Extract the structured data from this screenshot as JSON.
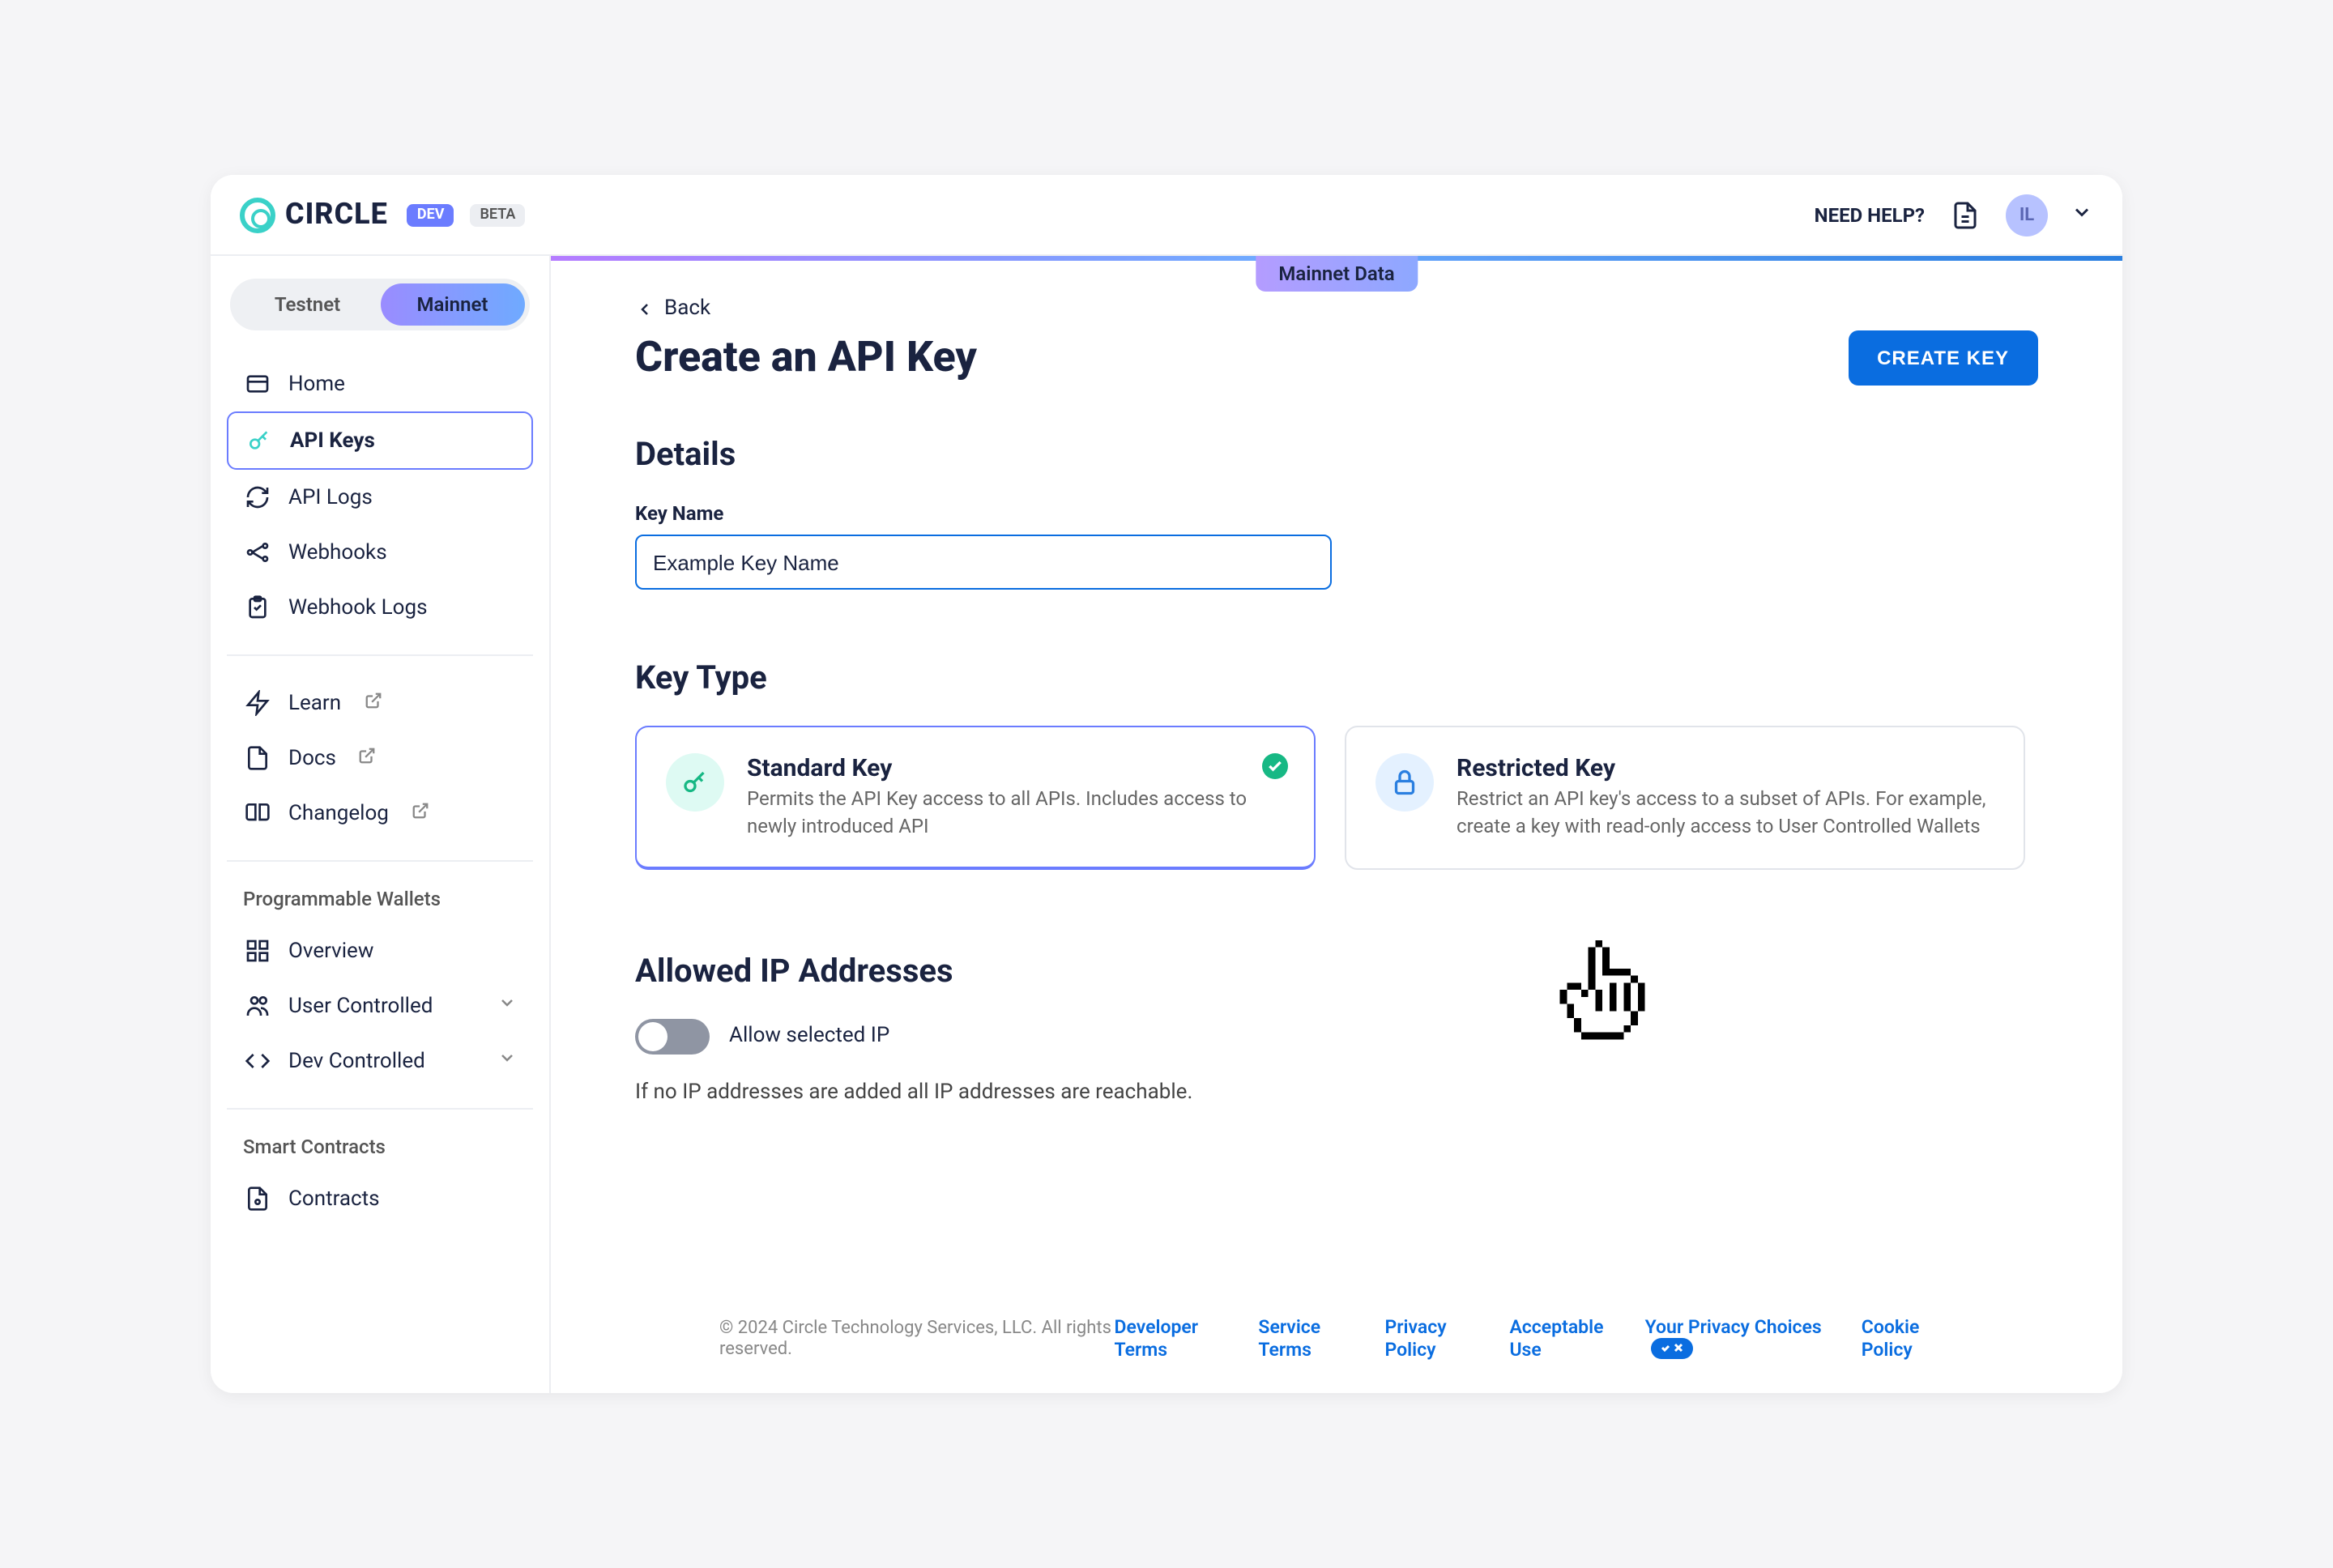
{
  "header": {
    "brand": "CIRCLE",
    "dev_badge": "DEV",
    "beta_badge": "BETA",
    "need_help": "NEED HELP?",
    "avatar_initials": "IL"
  },
  "sidebar": {
    "env": {
      "testnet": "Testnet",
      "mainnet": "Mainnet"
    },
    "nav_primary": [
      {
        "label": "Home"
      },
      {
        "label": "API Keys"
      },
      {
        "label": "API Logs"
      },
      {
        "label": "Webhooks"
      },
      {
        "label": "Webhook Logs"
      }
    ],
    "nav_resources": [
      {
        "label": "Learn"
      },
      {
        "label": "Docs"
      },
      {
        "label": "Changelog"
      }
    ],
    "section_pw": "Programmable Wallets",
    "nav_pw": [
      {
        "label": "Overview"
      },
      {
        "label": "User Controlled"
      },
      {
        "label": "Dev Controlled"
      }
    ],
    "section_sc": "Smart Contracts",
    "nav_sc": [
      {
        "label": "Contracts"
      }
    ]
  },
  "main": {
    "mainnet_tag": "Mainnet Data",
    "back": "Back",
    "title": "Create an API Key",
    "create_btn": "CREATE KEY",
    "details": {
      "heading": "Details",
      "key_name_label": "Key Name",
      "key_name_value": "Example Key Name"
    },
    "key_type": {
      "heading": "Key Type",
      "standard": {
        "title": "Standard Key",
        "desc": "Permits the API Key access to all APIs. Includes access to newly introduced API"
      },
      "restricted": {
        "title": "Restricted Key",
        "desc": "Restrict an API key's access to a subset of APIs. For example, create a key with read-only access to User Controlled Wallets"
      }
    },
    "allowed_ip": {
      "heading": "Allowed IP Addresses",
      "toggle_label": "Allow selected IP",
      "hint": "If no IP addresses are added all IP addresses are reachable."
    }
  },
  "footer": {
    "copyright": "© 2024 Circle Technology Services, LLC. All rights reserved.",
    "links": {
      "developer_terms": "Developer Terms",
      "service_terms": "Service Terms",
      "privacy_policy": "Privacy Policy",
      "acceptable_use": "Acceptable Use",
      "privacy_choices": "Your Privacy Choices",
      "cookie_policy": "Cookie Policy"
    }
  }
}
